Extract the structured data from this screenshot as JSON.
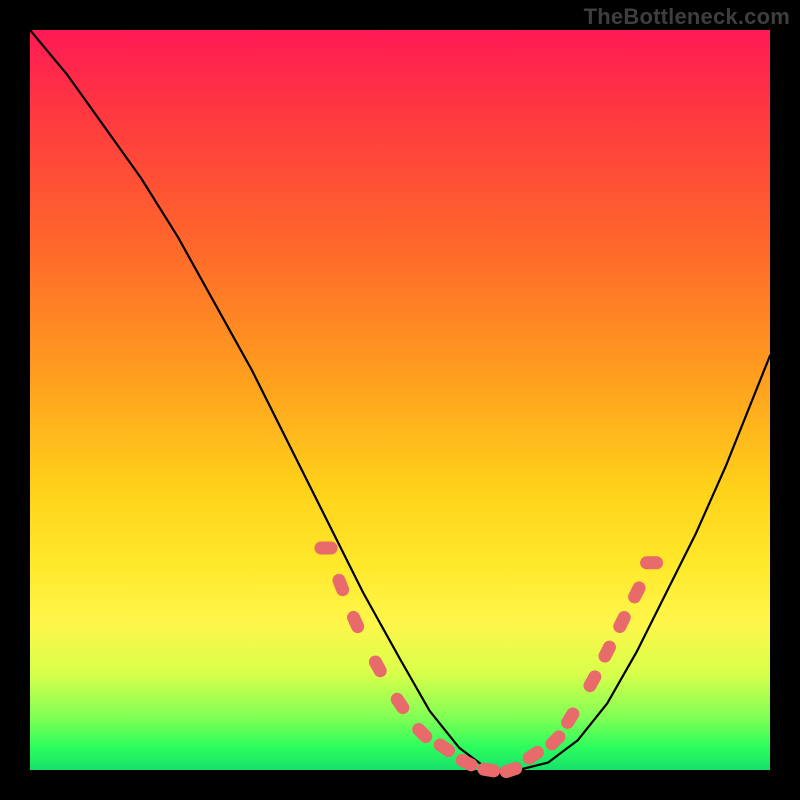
{
  "watermark": "TheBottleneck.com",
  "colors": {
    "frame": "#000000",
    "gradient_top": "#ff1a55",
    "gradient_mid": "#ffd21a",
    "gradient_bottom": "#18e06a",
    "curve": "#000000",
    "markers": "#e86a6a"
  },
  "chart_data": {
    "type": "line",
    "title": "",
    "xlabel": "",
    "ylabel": "",
    "xlim": [
      0,
      100
    ],
    "ylim": [
      0,
      100
    ],
    "grid": false,
    "x": [
      0,
      5,
      10,
      15,
      20,
      25,
      30,
      35,
      40,
      45,
      50,
      54,
      58,
      62,
      66,
      70,
      74,
      78,
      82,
      86,
      90,
      94,
      98,
      100
    ],
    "values": [
      100,
      94,
      87,
      80,
      72,
      63,
      54,
      44,
      34,
      24,
      15,
      8,
      3,
      0,
      0,
      1,
      4,
      9,
      16,
      24,
      32,
      41,
      51,
      56
    ],
    "annotations_note": "markers are decorative points near the valley of the curve",
    "markers": [
      {
        "x": 40,
        "y": 30
      },
      {
        "x": 42,
        "y": 25
      },
      {
        "x": 44,
        "y": 20
      },
      {
        "x": 47,
        "y": 14
      },
      {
        "x": 50,
        "y": 9
      },
      {
        "x": 53,
        "y": 5
      },
      {
        "x": 56,
        "y": 3
      },
      {
        "x": 59,
        "y": 1
      },
      {
        "x": 62,
        "y": 0
      },
      {
        "x": 65,
        "y": 0
      },
      {
        "x": 68,
        "y": 2
      },
      {
        "x": 71,
        "y": 4
      },
      {
        "x": 73,
        "y": 7
      },
      {
        "x": 76,
        "y": 12
      },
      {
        "x": 78,
        "y": 16
      },
      {
        "x": 80,
        "y": 20
      },
      {
        "x": 82,
        "y": 24
      },
      {
        "x": 84,
        "y": 28
      }
    ]
  }
}
